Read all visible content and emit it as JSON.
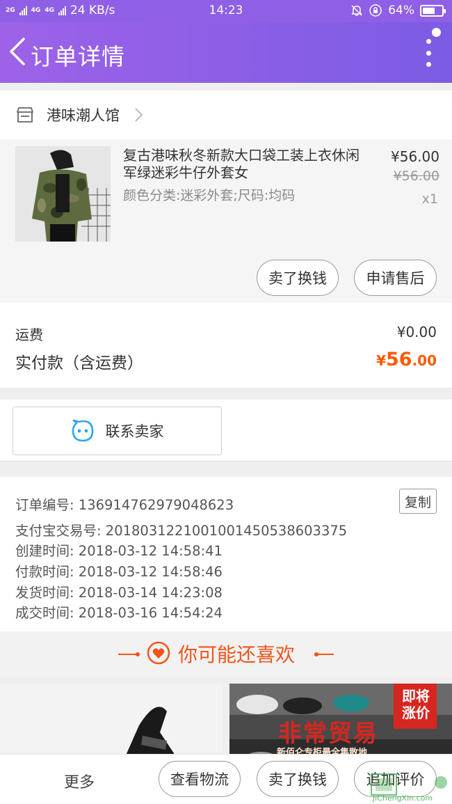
{
  "status_bar": {
    "net1": "2G",
    "net2": "4G",
    "net3": "4G",
    "speed": "24 KB/s",
    "time": "14:23",
    "battery": "64%",
    "battery_level": 0.64
  },
  "header": {
    "title": "订单详情",
    "icons": [
      "back-arrow-icon",
      "more-vertical-icon"
    ]
  },
  "shop": {
    "name": "港味潮人馆",
    "icon": "store-icon"
  },
  "item": {
    "title": "复古港味秋冬新款大口袋工装上衣休闲军绿迷彩牛仔外套女",
    "spec": "颜色分类:迷彩外套;尺码:均码",
    "price": "¥56.00",
    "original_price": "¥56.00",
    "quantity": "x1",
    "buttons": {
      "sell": "卖了换钱",
      "after_sale": "申请售后"
    }
  },
  "fees": {
    "shipping_label": "运费",
    "shipping_value": "¥0.00",
    "paid_label": "实付款（含运费）",
    "paid_currency": "¥",
    "paid_integer": "56",
    "paid_decimal": ".00"
  },
  "contact": {
    "label": "联系卖家"
  },
  "order_info": {
    "order_no_label": "订单编号:",
    "order_no": "136914762979048623",
    "copy_label": "复制",
    "alipay_label": "支付宝交易号:",
    "alipay_no": "2018031221001001450538603375",
    "created_label": "创建时间:",
    "created": "2018-03-12 14:58:41",
    "paid_label": "付款时间:",
    "paid": "2018-03-12 14:58:46",
    "shipped_label": "发货时间:",
    "shipped": "2018-03-14 14:23:08",
    "done_label": "成交时间:",
    "done": "2018-03-16 14:54:24"
  },
  "recommend": {
    "title": "你可能还喜欢",
    "banner_text": "非常贸易",
    "banner_sub": "新佰仑专柜最全集散地",
    "badge": "即将涨价"
  },
  "bottom_bar": {
    "more": "更多",
    "logistics": "查看物流",
    "sell": "卖了换钱",
    "review": "追加评价"
  },
  "watermark": {
    "text": "JiChengXin.com"
  },
  "colors": {
    "header_start": "#9d62e8",
    "header_end": "#7c5ce4",
    "accent_orange": "#ff5a00",
    "recommend_orange": "#f2541b",
    "contact_blue": "#2fa6ee"
  }
}
